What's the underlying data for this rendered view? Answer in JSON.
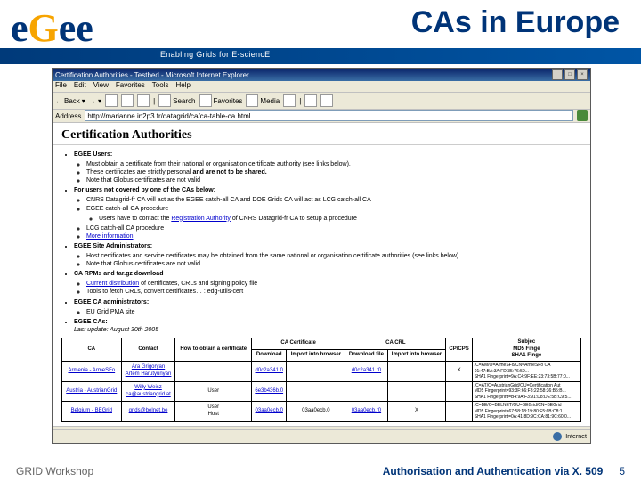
{
  "header": {
    "logo": {
      "e1": "e",
      "g": "G",
      "ee": "ee"
    },
    "title": "CAs in Europe",
    "tagline": "Enabling Grids for E-sciencE"
  },
  "ie": {
    "window_title": "Certification Authorities - Testbed - Microsoft Internet Explorer",
    "menu": [
      "File",
      "Edit",
      "View",
      "Favorites",
      "Tools",
      "Help"
    ],
    "toolbar": {
      "back": "Back",
      "search": "Search",
      "favorites": "Favorites",
      "media": "Media"
    },
    "address_label": "Address",
    "address_value": "http://marianne.in2p3.fr/datagrid/ca/ca-table-ca.html",
    "status": "Internet"
  },
  "page": {
    "h1": "Certification Authorities",
    "sections": {
      "users": {
        "label": "EGEE Users:",
        "items": [
          "Must obtain a certificate from their national or organisation certificate authority (see links below).",
          "These certificates are strictly personal and are not to be shared.",
          "Note that Globus certificates are not valid"
        ]
      },
      "notcovered": {
        "label": "For users not covered by one of the CAs below:",
        "items": [
          "CNRS Datagrid-fr CA will act as the EGEE catch-all CA and DOE Grids CA will act as LCG catch-all CA",
          "EGEE catch-all CA procedure",
          "LCG catch-all CA procedure"
        ],
        "subitems": [
          "Users have to contact the Registration Authority of CNRS Datagrid-fr CA to setup a procedure"
        ],
        "more": "More information"
      },
      "admins": {
        "label": "EGEE Site Administrators:",
        "items": [
          "Host certificates and service certificates may be obtained from the same national or organisation certificate authorities (see links below)",
          "Note that Globus certificates are not valid"
        ]
      },
      "rpms": {
        "label": "CA RPMs and tar.gz download",
        "items": [
          "Current distribution of certificates, CRLs and signing policy file",
          "Tools to fetch CRLs, convert certificates… : edg-utils-cert"
        ]
      },
      "caadmins": {
        "label": "EGEE CA administrators:",
        "items": [
          "EU Grid PMA site"
        ]
      },
      "cas": {
        "label": "EGEE CAs:",
        "update": "Last update: August 30th 2005"
      }
    },
    "table": {
      "headers": {
        "ca": "CA",
        "contact": "Contact",
        "howto": "How to obtain a certificate",
        "cert_group": "CA Certificate",
        "crl_group": "CA CRL",
        "download": "Download",
        "import": "Import into browser",
        "download2": "Download file",
        "import2": "Import into browser",
        "cp": "CP/CPS",
        "subj": "Subjec",
        "md5": "MD5 Finge",
        "sha1": "SHA1 Finge"
      },
      "rows": [
        {
          "ca": "Armenia - ArmeSFo",
          "contact": "Ara Grigoryan\nArtem Harutyunyan",
          "howto": "",
          "d1": "d0c2a341.0",
          "i1": "",
          "d2": "d0c2a341.r0",
          "i2": "",
          "cp": "X",
          "hash": "/C=AM/O=ArmeSFo/CN=ArmeSFo CA\n01:47:BA:3A:FD:35:76:59...\nSHA1 Fingerprint=9A:C4:9F:EE:23:73:5B:77:0..."
        },
        {
          "ca": "Austria - AustrianGrid",
          "contact": "Willy Weisz\nca@austriangrid.at",
          "howto": "User",
          "d1": "6e3b436b.0",
          "i1": "",
          "d2": "",
          "i2": "",
          "cp": "",
          "hash": "/C=AT/O=AustrianGrid/OU=Certification Aut\nMD5 Fingerprint=93:3F:66:F8:22:58:36:B5:B...\nSHA1 Fingerprint=B4:9A:F3:91:D8:DE:5B:C9:5..."
        },
        {
          "ca": "Belgium - BEGrid",
          "contact": "grids@belnet.be",
          "howto": "User\nHost",
          "d1": "03aa0ecb.0",
          "i1": "03aa0ecb.0",
          "d2": "03aa0ecb.r0",
          "i2": "X",
          "cp": "",
          "hash": "/C=BE/O=BELNET/OU=BEGrid/CN=BEGrid\nMD5 Fingerprint=67:58:18:19:80:F5:6B:C8:1...\nSHA1 Fingerprint=0A:41:8D:9C:CA:81:9C:60:0..."
        }
      ]
    }
  },
  "footer": {
    "left": "GRID Workshop",
    "right": "Authorisation and Authentication via X. 509",
    "page": "5"
  }
}
